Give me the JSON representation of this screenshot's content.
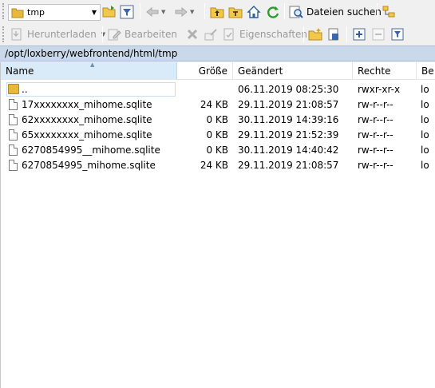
{
  "toolbar1": {
    "dir_value": "tmp",
    "search_label": "Dateien suchen"
  },
  "toolbar2": {
    "download_label": "Herunterladen",
    "edit_label": "Bearbeiten",
    "properties_label": "Eigenschaften"
  },
  "path": "/opt/loxberry/webfrontend/html/tmp",
  "columns": {
    "name": "Name",
    "size": "Größe",
    "modified": "Geändert",
    "rights": "Rechte",
    "owner": "Be"
  },
  "files": [
    {
      "name": "..",
      "size": "",
      "modified": "06.11.2019 08:25:30",
      "rights": "rwxr-xr-x",
      "owner": "lo"
    },
    {
      "name": "17xxxxxxxx_mihome.sqlite",
      "size": "24 KB",
      "modified": "29.11.2019 21:08:57",
      "rights": "rw-r--r--",
      "owner": "lo"
    },
    {
      "name": "62xxxxxxxx_mihome.sqlite",
      "size": "0 KB",
      "modified": "30.11.2019 14:39:16",
      "rights": "rw-r--r--",
      "owner": "lo"
    },
    {
      "name": "65xxxxxxxx_mihome.sqlite",
      "size": "0 KB",
      "modified": "29.11.2019 21:52:39",
      "rights": "rw-r--r--",
      "owner": "lo"
    },
    {
      "name": "6270854995__mihome.sqlite",
      "size": "0 KB",
      "modified": "30.11.2019 14:40:42",
      "rights": "rw-r--r--",
      "owner": "lo"
    },
    {
      "name": "6270854995_mihome.sqlite",
      "size": "24 KB",
      "modified": "29.11.2019 21:08:57",
      "rights": "rw-r--r--",
      "owner": "lo"
    }
  ]
}
